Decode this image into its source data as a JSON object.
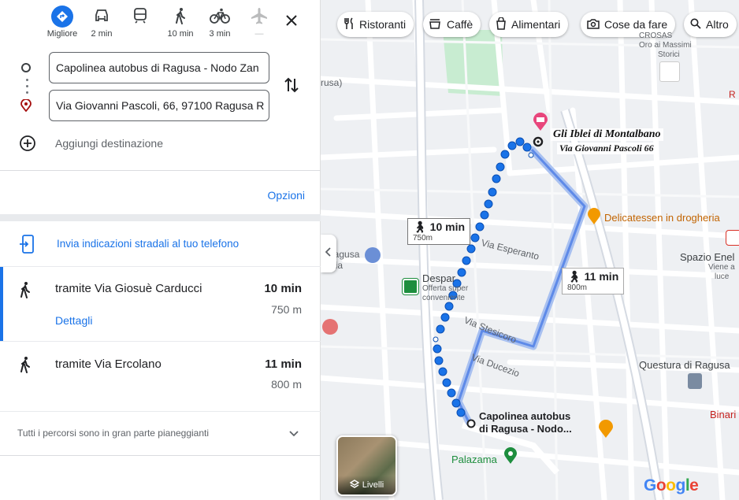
{
  "modes": [
    {
      "label": "Migliore",
      "icon": "diamond-route-icon"
    },
    {
      "label": "2 min",
      "icon": "car-icon"
    },
    {
      "label": "",
      "icon": "train-icon"
    },
    {
      "label": "10 min",
      "icon": "walk-icon"
    },
    {
      "label": "3 min",
      "icon": "bike-icon"
    },
    {
      "label": "—",
      "icon": "plane-icon"
    }
  ],
  "origin": "Capolinea autobus di Ragusa - Nodo Zan",
  "destination": "Via Giovanni Pascoli, 66, 97100 Ragusa R",
  "add_destination": "Aggiungi destinazione",
  "options": "Opzioni",
  "send_to_phone": "Invia indicazioni stradali al tuo telefono",
  "routes": [
    {
      "title": "tramite Via Giosuè Carducci",
      "time": "10 min",
      "distance": "750 m",
      "details": "Dettagli"
    },
    {
      "title": "tramite Via Ercolano",
      "time": "11 min",
      "distance": "800 m"
    }
  ],
  "footer_note": "Tutti i percorsi sono in gran parte pianeggianti",
  "chips": [
    "Ristoranti",
    "Caffè",
    "Alimentari",
    "Cose da fare",
    "Altro"
  ],
  "map": {
    "dest_title": "Gli Iblei di Montalbano",
    "dest_sub": "Via Giovanni Pascoli 66",
    "origin_label1": "Capolinea autobus",
    "origin_label2": "di Ragusa - Nodo...",
    "bubble1_time": "10 min",
    "bubble1_dist": "750m",
    "bubble2_time": "11 min",
    "bubble2_dist": "800m",
    "streets": [
      "Via Esperanto",
      "Via Stesicoro",
      "Via Ducezio"
    ],
    "pois": {
      "delicatessen": "Delicatessen in drogheria",
      "spazio": "Spazio Enel",
      "spazio_sub1": "Viene a",
      "spazio_sub2": "luce",
      "despar": "Despar",
      "despar_sub1": "Offerta super",
      "despar_sub2": "conveniente",
      "questura": "Questura di Ragusa",
      "palazama": "Palazama",
      "binari": "Binari",
      "ragusa": "Ragusa",
      "ragusa_cut": "aria",
      "rusa": "rusa)",
      "oro1": "CROSAS",
      "oro2": "Oro ai Massimi",
      "oro3": "Storici",
      "r_edge": "R"
    },
    "layers": "Livelli",
    "google": "Google"
  },
  "colors": {
    "accent": "#1a73e8",
    "route": "#1a73e8",
    "alt_route": "#a8c0f0"
  }
}
